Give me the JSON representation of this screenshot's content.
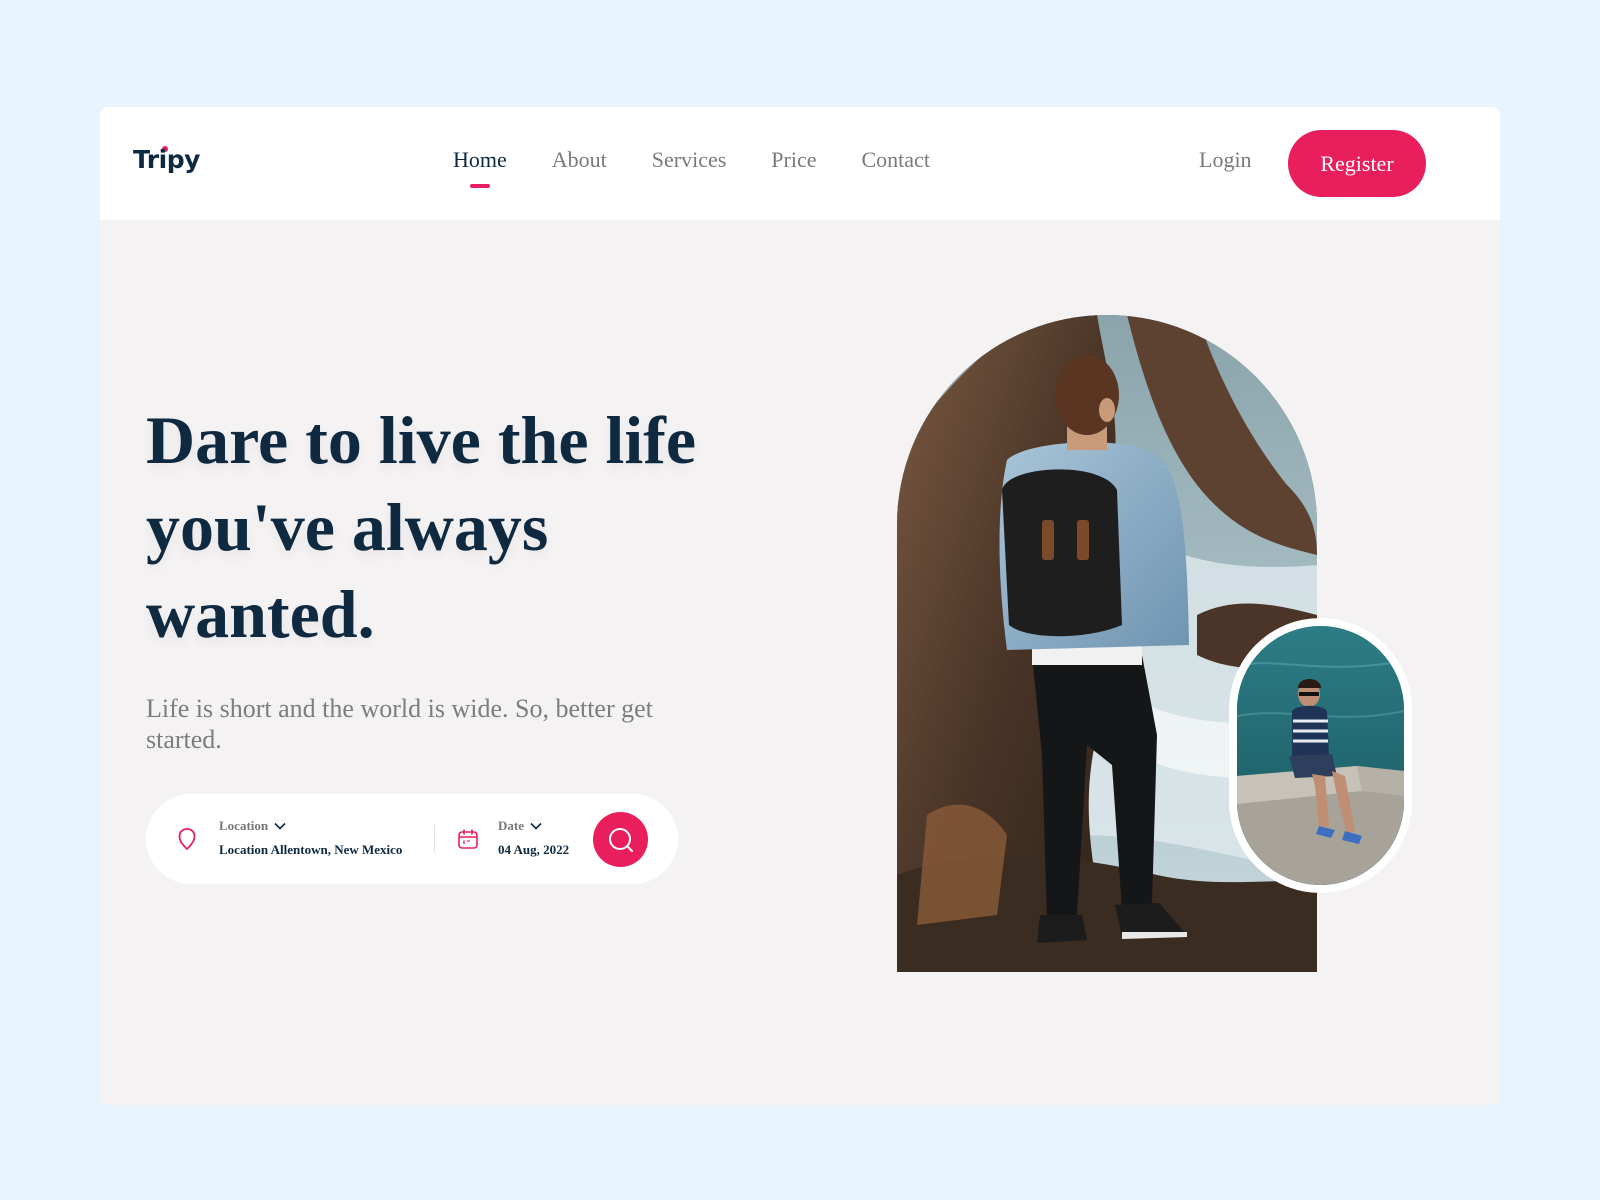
{
  "brand": {
    "name": "Tripy",
    "accent": "#e91e5d",
    "text_dark": "#0f2940"
  },
  "nav": {
    "links": [
      {
        "label": "Home",
        "active": true
      },
      {
        "label": "About",
        "active": false
      },
      {
        "label": "Services",
        "active": false
      },
      {
        "label": "Price",
        "active": false
      },
      {
        "label": "Contact",
        "active": false
      }
    ],
    "login_label": "Login",
    "register_label": "Register"
  },
  "hero": {
    "headline": "Dare to live the life you've always wanted.",
    "subtext": "Life is short and the world is wide. So, better get started."
  },
  "search": {
    "location_label": "Location",
    "location_value": "Location Allentown, New Mexico",
    "date_label": "Date",
    "date_value": "04 Aug, 2022",
    "icons": [
      "map-pin-icon",
      "calendar-icon",
      "chevron-down-icon",
      "search-icon"
    ]
  },
  "images": {
    "main": "hiker-with-backpack-on-sea-cliffs-photo",
    "secondary": "man-sitting-on-seawall-by-water-photo"
  }
}
